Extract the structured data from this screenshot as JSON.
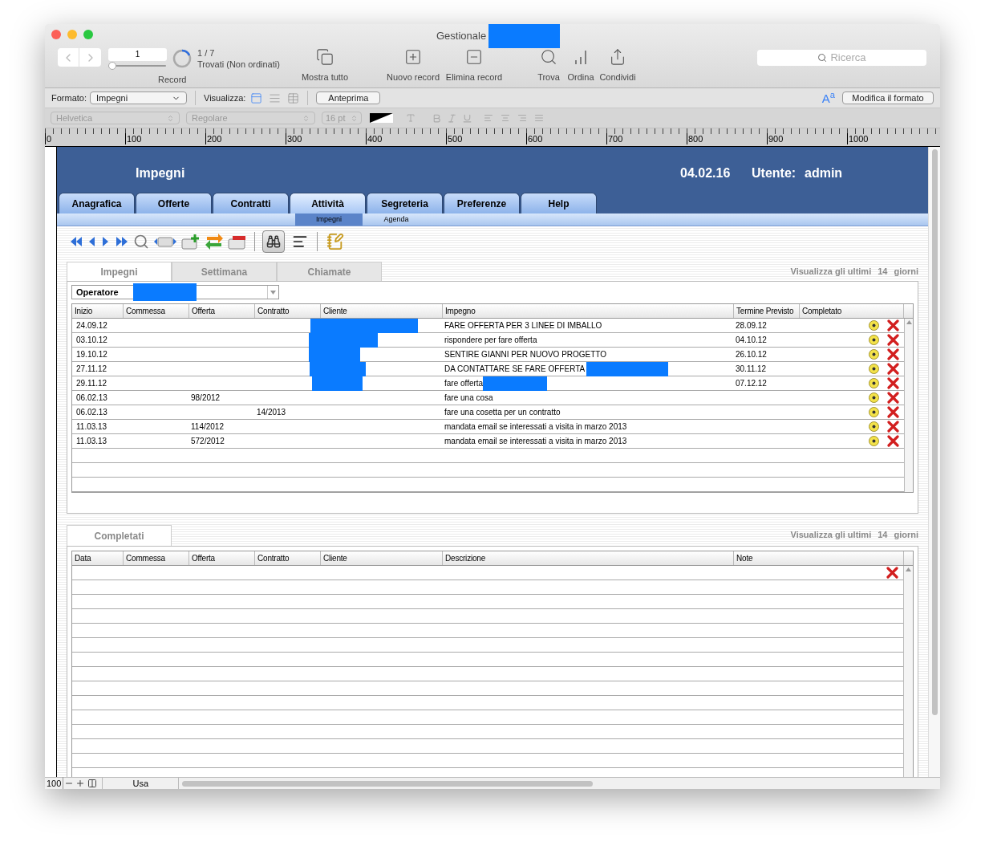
{
  "window": {
    "title": "Gestionale",
    "title_redacted": true
  },
  "toolbar": {
    "record_value": "1",
    "record_slider": {
      "level": 0
    },
    "found_count": "1 / 7",
    "found_label": "Trovati (Non ordinati)",
    "record_label": "Record",
    "buttons": [
      {
        "kind": "show_all",
        "label": "Mostra tutto"
      },
      {
        "kind": "new",
        "label": "Nuovo record"
      },
      {
        "kind": "delete",
        "label": "Elimina record"
      },
      {
        "kind": "find",
        "label": "Trova"
      },
      {
        "kind": "sort",
        "label": "Ordina"
      },
      {
        "kind": "share",
        "label": "Condividi"
      }
    ],
    "search": {
      "placeholder": "Ricerca"
    }
  },
  "format_bar": {
    "format_label": "Formato:",
    "format_value": "Impegni",
    "view_label": "Visualizza:",
    "views": [
      {
        "kind": "form",
        "selected": true
      },
      {
        "kind": "list",
        "selected": false
      },
      {
        "kind": "table",
        "selected": false
      }
    ],
    "preview": "Anteprima",
    "font_icon": "A$^{a}$",
    "modify": "Modifica il formato"
  },
  "font_bar": {
    "font": "Helvetica",
    "style": "Regolare",
    "size": "16 pt"
  },
  "ruler": {
    "marks": [
      "0",
      "100",
      "200",
      "300",
      "400",
      "500",
      "600",
      "700",
      "800",
      "900",
      "1000"
    ]
  },
  "header": {
    "title": "Impegni",
    "date": "04.02.16",
    "user_label": "Utente:",
    "user": "admin"
  },
  "nav_tabs": [
    {
      "label": "Anagrafica",
      "selected": false
    },
    {
      "label": "Offerte",
      "selected": false
    },
    {
      "label": "Contratti",
      "selected": false
    },
    {
      "label": "Attività",
      "selected": true
    },
    {
      "label": "Segreteria",
      "selected": false
    },
    {
      "label": "Preferenze",
      "selected": false
    },
    {
      "label": "Help",
      "selected": false
    }
  ],
  "sub_tabs": [
    {
      "label": "Impegni",
      "selected": true
    },
    {
      "label": "Agenda",
      "selected": false
    }
  ],
  "impegni_panel": {
    "tabs": [
      {
        "label": "Impegni",
        "selected": true
      },
      {
        "label": "Settimana",
        "selected": false
      },
      {
        "label": "Chiamate",
        "selected": false
      }
    ],
    "filter": {
      "prefix": "Visualizza gli ultimi",
      "days": "14",
      "suffix": "giorni"
    },
    "operator": {
      "label": "Operatore",
      "redacted": true
    },
    "columns": [
      "Inizio",
      "Commessa",
      "Offerta",
      "Contratto",
      "Cliente",
      "Impegno",
      "Termine Previsto",
      "Completato"
    ],
    "rows": [
      {
        "start": "24.09.12",
        "commessa": "",
        "offerta": "",
        "contratto": "",
        "client_redacted": true,
        "impegno": "FARE OFFERTA PER 3 LINEE DI IMBALLO",
        "impegno_redacted": false,
        "due": "28.09.12"
      },
      {
        "start": "03.10.12",
        "commessa": "",
        "offerta": "",
        "contratto": "",
        "client_redacted": true,
        "impegno": "rispondere per fare offerta",
        "impegno_redacted": false,
        "due": "04.10.12"
      },
      {
        "start": "19.10.12",
        "commessa": "",
        "offerta": "",
        "contratto": "",
        "client_redacted": true,
        "impegno": "SENTIRE GIANNI PER NUOVO PROGETTO",
        "impegno_redacted": false,
        "due": "26.10.12"
      },
      {
        "start": "27.11.12",
        "commessa": "",
        "offerta": "",
        "contratto": "",
        "client_redacted": true,
        "impegno": "DA CONTATTARE SE FARE OFFERTA",
        "impegno_redacted": true,
        "due": "30.11.12"
      },
      {
        "start": "29.11.12",
        "commessa": "",
        "offerta": "",
        "contratto": "",
        "client_redacted": true,
        "impegno": "fare offerta",
        "impegno_redacted": true,
        "due": "07.12.12"
      },
      {
        "start": "06.02.13",
        "commessa": "",
        "offerta": "98/2012",
        "contratto": "",
        "client_redacted": false,
        "impegno": "fare una cosa",
        "impegno_redacted": false,
        "due": ""
      },
      {
        "start": "06.02.13",
        "commessa": "",
        "offerta": "",
        "contratto": "14/2013",
        "client_redacted": false,
        "impegno": "fare una cosetta per un contratto",
        "impegno_redacted": false,
        "due": ""
      },
      {
        "start": "11.03.13",
        "commessa": "",
        "offerta": "114/2012",
        "contratto": "",
        "client_redacted": false,
        "impegno": "mandata email se interessati a visita in marzo 2013",
        "impegno_redacted": false,
        "due": ""
      },
      {
        "start": "11.03.13",
        "commessa": "",
        "offerta": "572/2012",
        "contratto": "",
        "client_redacted": false,
        "impegno": "mandata email se interessati a visita in marzo 2013",
        "impegno_redacted": false,
        "due": ""
      }
    ]
  },
  "completati_panel": {
    "tab": "Completati",
    "filter": {
      "prefix": "Visualizza gli ultimi",
      "days": "14",
      "suffix": "giorni"
    },
    "columns": [
      "Data",
      "Commessa",
      "Offerta",
      "Contratto",
      "Cliente",
      "Descrizione",
      "Note"
    ]
  },
  "status_bar": {
    "zoom": "100",
    "mode": "Usa"
  }
}
